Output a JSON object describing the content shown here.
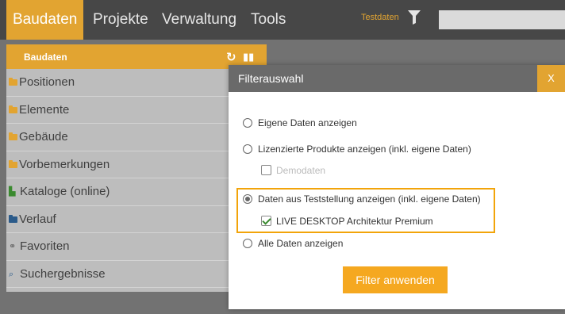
{
  "nav": {
    "items": [
      {
        "label": "Baudaten",
        "active": true
      },
      {
        "label": "Projekte",
        "active": false
      },
      {
        "label": "Verwaltung",
        "active": false
      },
      {
        "label": "Tools",
        "active": false
      }
    ],
    "filter_label": "Testdaten",
    "search_placeholder": ""
  },
  "sidebar": {
    "title": "Baudaten",
    "items": [
      {
        "label": "Positionen",
        "icon": "folder-icon"
      },
      {
        "label": "Elemente",
        "icon": "folder-icon"
      },
      {
        "label": "Gebäude",
        "icon": "folder-icon"
      },
      {
        "label": "Vorbemerkungen",
        "icon": "folder-icon"
      },
      {
        "label": "Kataloge (online)",
        "icon": "book-icon"
      },
      {
        "label": "Verlauf",
        "icon": "folder-icon"
      },
      {
        "label": "Favoriten",
        "icon": "paperclip-icon"
      },
      {
        "label": "Suchergebnisse",
        "icon": "search-icon"
      }
    ]
  },
  "modal": {
    "title": "Filterauswahl",
    "close_label": "X",
    "options": [
      {
        "label": "Eigene Daten anzeigen",
        "checked": false
      },
      {
        "label": "Lizenzierte Produkte anzeigen (inkl. eigene Daten)",
        "checked": false
      },
      {
        "label": "Daten aus Teststellung anzeigen (inkl. eigene Daten)",
        "checked": true
      },
      {
        "label": "Alle Daten anzeigen",
        "checked": false
      }
    ],
    "demodaten_label": "Demodaten",
    "live_desktop_label": "LIVE DESKTOP Architektur Premium",
    "apply_label": "Filter anwenden"
  },
  "colors": {
    "accent": "#e2a431",
    "topbar": "#474747",
    "sidebar_bg": "#bdbdbd",
    "highlight_border": "#f2a40a"
  }
}
